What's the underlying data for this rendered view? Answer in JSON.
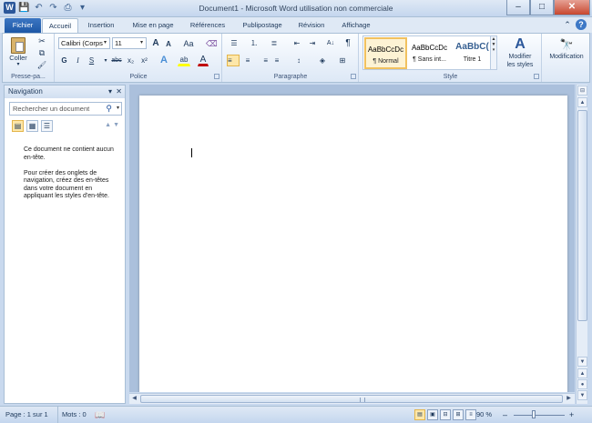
{
  "window": {
    "title": "Document1 - Microsoft Word utilisation non commerciale",
    "minimize_label": "–",
    "maximize_label": "□",
    "close_label": "✕"
  },
  "quick_access": {
    "app_icon": "W",
    "save_icon": "💾",
    "undo_icon": "↶",
    "redo_icon": "↷",
    "print_icon": "⎙",
    "customize_icon": "▾"
  },
  "tabs": [
    {
      "label": "Fichier"
    },
    {
      "label": "Accueil"
    },
    {
      "label": "Insertion"
    },
    {
      "label": "Mise en page"
    },
    {
      "label": "Références"
    },
    {
      "label": "Publipostage"
    },
    {
      "label": "Révision"
    },
    {
      "label": "Affichage"
    }
  ],
  "ribbon_controls": {
    "minimize_ribbon_icon": "⌃",
    "help_icon": "?"
  },
  "clipboard": {
    "group_label": "Presse-pa...",
    "paste_label": "Coller",
    "paste_arrow": "▾",
    "cut_icon": "✂",
    "copy_icon": "⧉",
    "format_painter_icon": "🖌"
  },
  "font": {
    "group_label": "Police",
    "font_name": "Calibri (Corps",
    "font_size": "11",
    "grow_label": "A",
    "shrink_label": "A",
    "case_label": "Aa",
    "clear_format_label": "⌫",
    "bold": "G",
    "italic": "I",
    "underline": "S",
    "strike": "abc",
    "subscript": "x₂",
    "superscript": "x²",
    "effects_label": "A",
    "highlight_label": "ab",
    "color_label": "A"
  },
  "paragraph": {
    "group_label": "Paragraphe",
    "bullets_icon": "☰",
    "numbering_icon": "⒈",
    "multilevel_icon": "≣",
    "decrease_indent_icon": "⇤",
    "increase_indent_icon": "⇥",
    "sort_icon": "A↓",
    "show_marks_icon": "¶",
    "align_left_icon": "≡",
    "align_center_icon": "≡",
    "align_right_icon": "≡",
    "justify_icon": "≡",
    "line_spacing_icon": "↕",
    "shading_icon": "◈",
    "borders_icon": "⊞"
  },
  "styles": {
    "group_label": "Style",
    "items": [
      {
        "preview": "AaBbCcDc",
        "name": "¶ Normal"
      },
      {
        "preview": "AaBbCcDc",
        "name": "¶ Sans int..."
      },
      {
        "preview": "AaBbC(",
        "name": "Titre 1"
      }
    ],
    "change_styles_label": "Modifier les styles",
    "change_styles_icon": "A",
    "modification_label": "Modification",
    "modification_icon": "🔭"
  },
  "navigation": {
    "title": "Navigation",
    "menu_icon": "▾",
    "close_icon": "✕",
    "search_placeholder": "Rechercher un document",
    "search_icon": "⚲",
    "search_dropdown": "▾",
    "view_headings_icon": "▤",
    "view_pages_icon": "▦",
    "view_results_icon": "☰",
    "prev_icon": "▲",
    "next_icon": "▼",
    "message_1": "Ce document ne contient aucun en-tête.",
    "message_2": "Pour créer des onglets de navigation, créez des en-têtes dans votre document en appliquant les styles d'en-tête."
  },
  "scroll": {
    "up": "▲",
    "down": "▼",
    "prev_page": "▲",
    "select_browse": "●",
    "next_page": "▼",
    "left": "◀",
    "right": "▶",
    "ruler_icon": "⊟"
  },
  "status": {
    "page": "Page : 1 sur 1",
    "words": "Mots : 0",
    "proofing_icon": "📖",
    "views": [
      "▤",
      "▣",
      "⊟",
      "⊞",
      "≡"
    ],
    "zoom": "90 %",
    "zoom_out": "–",
    "zoom_in": "+"
  },
  "colors": {
    "accent": "#2b579a",
    "ribbon_bg": "#dfe9f5",
    "highlight": "#fde7a9",
    "font_color_bar": "#c00000",
    "highlight_bar": "#ffff00"
  }
}
